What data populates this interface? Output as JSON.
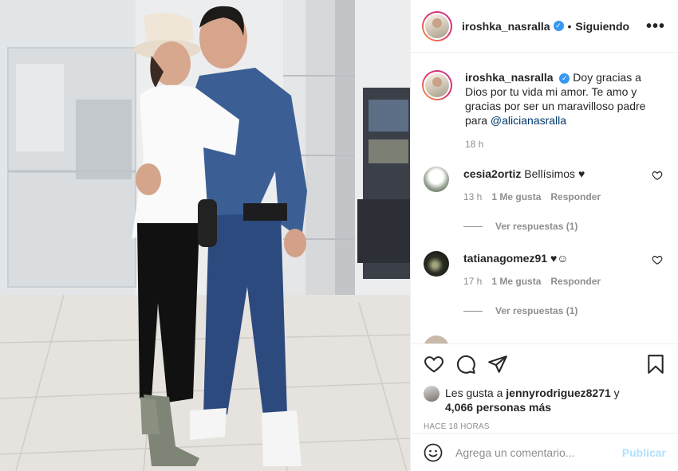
{
  "post": {
    "username": "iroshka_nasralla",
    "verified_icon": "verified-badge-icon",
    "separator": "•",
    "follow_label": "Siguiendo",
    "more_icon": "more-options-icon",
    "more_label": "•••"
  },
  "caption": {
    "username": "iroshka_nasralla",
    "text": "Doy gracias a Dios por tu vida mi amor. Te amo y gracias por ser un maravilloso padre para",
    "mention": "@alicianasralla",
    "time": "18 h"
  },
  "comments": [
    {
      "username": "cesia2ortiz",
      "text": "Bellísimos ♥",
      "time": "13 h",
      "likes": "1 Me gusta",
      "reply_label": "Responder",
      "view_replies": "Ver respuestas (1)"
    },
    {
      "username": "tatianagomez91",
      "text": "♥☺",
      "time": "17 h",
      "likes": "1 Me gusta",
      "reply_label": "Responder",
      "view_replies": "Ver respuestas (1)"
    }
  ],
  "actions": {
    "like_icon": "heart-icon",
    "comment_icon": "comment-icon",
    "share_icon": "share-icon",
    "save_icon": "bookmark-icon"
  },
  "likes": {
    "prefix": "Les gusta a",
    "user": "jennyrodriguez8271",
    "middle": "y",
    "others": "4,066 personas más"
  },
  "time_ago": "HACE 18 HORAS",
  "add_comment": {
    "emoji_icon": "emoji-icon",
    "placeholder": "Agrega un comentario...",
    "post_label": "Publicar"
  },
  "colors": {
    "text": "#262626",
    "secondary": "#8e8e8e",
    "verified": "#3897f0",
    "mention": "#00376b",
    "post_disabled": "#b2dffc"
  }
}
